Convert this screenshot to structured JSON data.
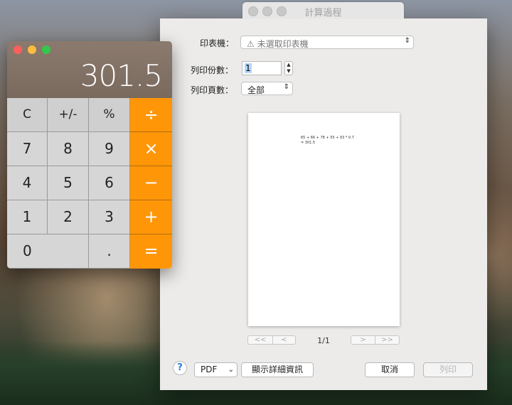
{
  "print_dialog": {
    "title": "計算過程",
    "printer_label": "印表機：",
    "printer_value": "⚠ 未選取印表機",
    "copies_label": "列印份數：",
    "copies_value": "1",
    "pages_label": "列印頁數：",
    "pages_value": "全部",
    "preview_line1": "65 + 66 + 78 + 55 + 93 * 0.7",
    "preview_line2": "= 301.5",
    "page_indicator": "1/1",
    "first_page": "<<",
    "prev_page": "<",
    "next_page": ">",
    "last_page": ">>",
    "help": "?",
    "pdf_label": "PDF",
    "details_label": "顯示詳細資訊",
    "cancel_label": "取消",
    "print_label": "列印"
  },
  "calculator": {
    "display": "301.5",
    "keys": {
      "clear": "C",
      "sign": "+/-",
      "percent": "%",
      "divide": "÷",
      "seven": "7",
      "eight": "8",
      "nine": "9",
      "multiply": "×",
      "four": "4",
      "five": "5",
      "six": "6",
      "minus": "−",
      "one": "1",
      "two": "2",
      "three": "3",
      "plus": "+",
      "zero": "0",
      "decimal": ".",
      "equals": "="
    }
  }
}
